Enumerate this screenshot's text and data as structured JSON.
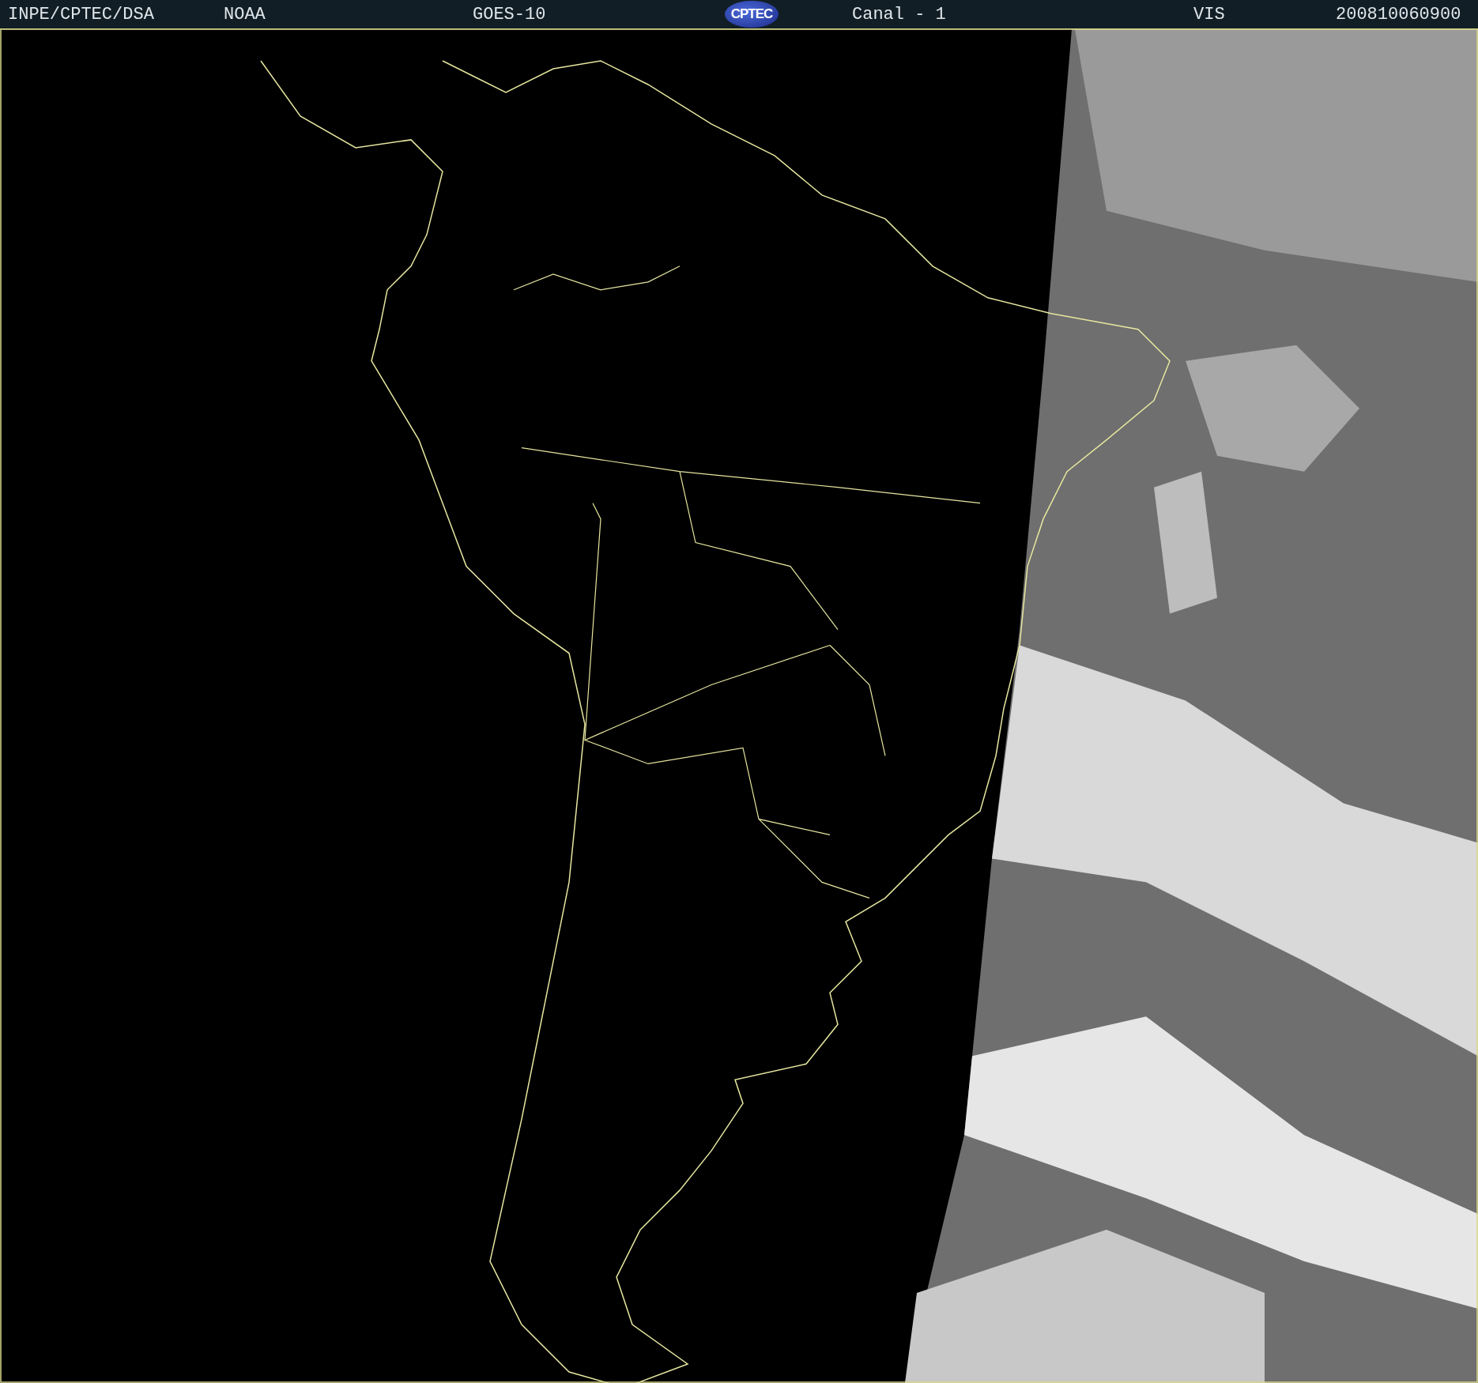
{
  "header": {
    "items": [
      {
        "kind": "label",
        "text": "INPE/CPTEC/DSA"
      },
      {
        "kind": "label",
        "text": "NOAA"
      },
      {
        "kind": "label",
        "text": "GOES-10"
      },
      {
        "kind": "logo",
        "text": "CPTEC"
      },
      {
        "kind": "label",
        "text": "Canal - 1"
      },
      {
        "kind": "label",
        "text": "VIS"
      },
      {
        "kind": "label",
        "text": "200810060900"
      }
    ]
  }
}
